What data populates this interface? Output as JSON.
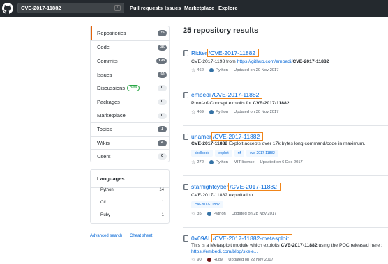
{
  "header": {
    "search_value": "CVE-2017-11882",
    "slash_hint": "/",
    "nav": [
      "Pull requests",
      "Issues",
      "Marketplace",
      "Explore"
    ]
  },
  "sidebar": {
    "items": [
      {
        "label": "Repositories",
        "count": "25"
      },
      {
        "label": "Code",
        "count": "3K"
      },
      {
        "label": "Commits",
        "count": "198"
      },
      {
        "label": "Issues",
        "count": "50"
      },
      {
        "label": "Discussions",
        "badge": "Beta",
        "count": "0"
      },
      {
        "label": "Packages",
        "count": "0"
      },
      {
        "label": "Marketplace",
        "count": "0"
      },
      {
        "label": "Topics",
        "count": "1"
      },
      {
        "label": "Wikis",
        "count": "4"
      },
      {
        "label": "Users",
        "count": "0"
      }
    ],
    "languages_title": "Languages",
    "languages": [
      {
        "name": "Python",
        "count": "14"
      },
      {
        "name": "C#",
        "count": "1"
      },
      {
        "name": "Ruby",
        "count": "1"
      }
    ],
    "advanced_search": "Advanced search",
    "cheat_sheet": "Cheat sheet"
  },
  "results": {
    "title": "25 repository results",
    "items": [
      {
        "owner": "Ridter",
        "name": "CVE-2017-11882",
        "desc_prefix": "CVE-2017-1198 from ",
        "desc_link": "https://github.com/embedi/",
        "desc_bold": "CVE-2017-11882",
        "stars": "462",
        "language": "Python",
        "updated": "Updated on 29 Nov 2017"
      },
      {
        "owner": "embedi",
        "name": "CVE-2017-11882",
        "desc_text": "Proof-of-Concept exploits for ",
        "desc_bold": "CVE-2017-11882",
        "stars": "469",
        "language": "Python",
        "updated": "Updated on 30 Nov 2017"
      },
      {
        "owner": "unamer",
        "name": "CVE-2017-11882",
        "desc_bold": "CVE-2017-11882",
        "desc_text": " Exploit accepts over 17k bytes long command/code in maximum.",
        "topics": [
          "shellcode",
          "exploit",
          "rtf",
          "cve-2017-11882"
        ],
        "stars": "272",
        "language": "Python",
        "license": "MIT license",
        "updated": "Updated on 6 Dec 2017"
      },
      {
        "owner": "starnightcyber",
        "name": "CVE-2017-11882",
        "desc_bold": "CVE-2017-11882",
        "desc_text": " exploitation",
        "topics": [
          "cve-2017-11882"
        ],
        "stars": "35",
        "language": "Python",
        "updated": "Updated on 28 Nov 2017"
      },
      {
        "owner": "0x09AL",
        "name": "CVE-2017-11882-metasploit",
        "desc_text": "This is a Metasploit module which exploits ",
        "desc_bold": "CVE-2017-11882",
        "desc_suffix": " using the POC released here :",
        "desc_link2": "https://embedi.com/blog/skele...",
        "stars": "90",
        "language": "Ruby",
        "updated": "Updated on 22 Nov 2017"
      }
    ]
  },
  "colors": {
    "header_bg": "#24292e",
    "link": "#0366d6",
    "highlight_box": "#f0851a",
    "python": "#3572A5",
    "ruby": "#701516",
    "selected_accent": "#e36209"
  }
}
